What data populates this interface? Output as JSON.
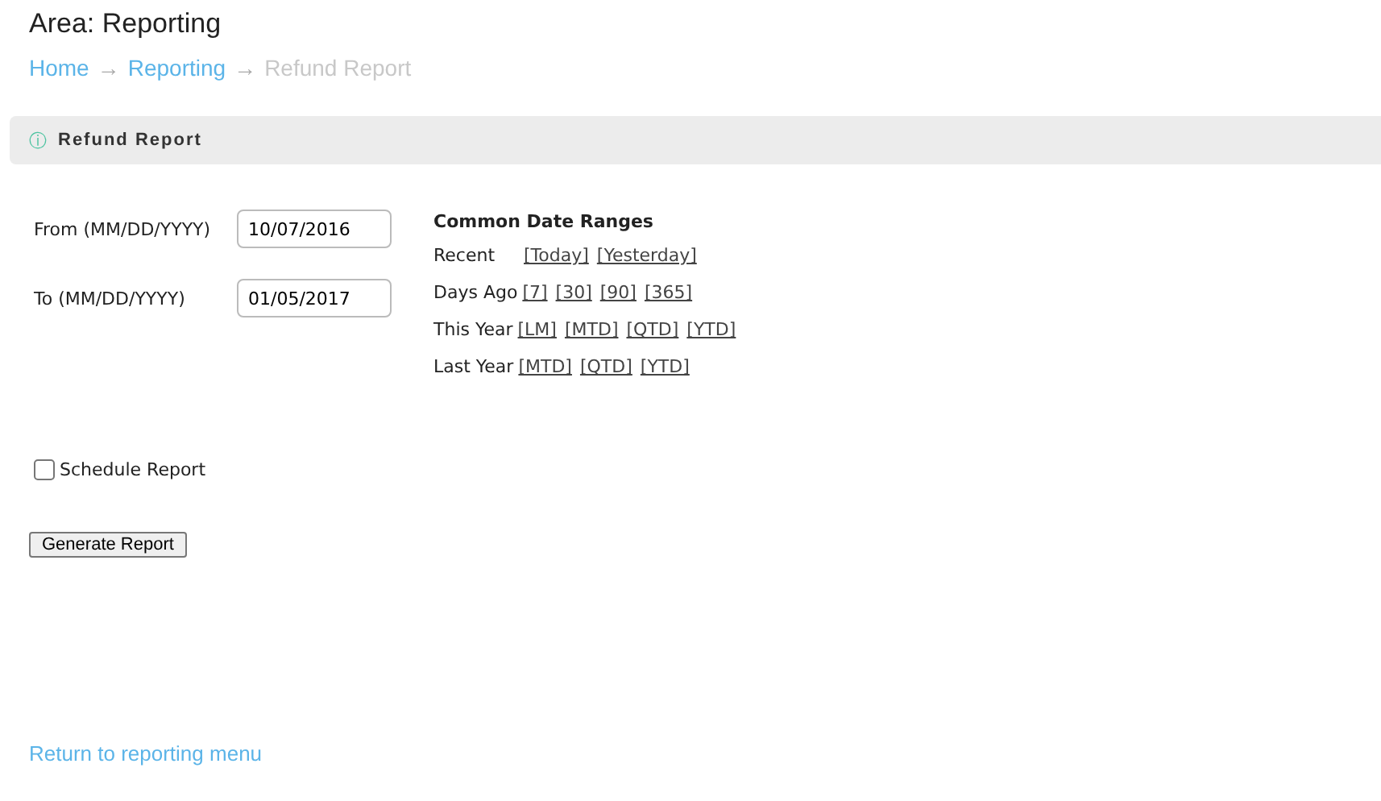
{
  "area_title": "Area: Reporting",
  "breadcrumb": [
    {
      "label": "Home",
      "current": false,
      "separator": "→"
    },
    {
      "label": "Reporting",
      "current": false,
      "separator": "→"
    },
    {
      "label": "Refund Report",
      "current": true
    }
  ],
  "panel": {
    "icon": "ⓘ",
    "title": "Refund Report"
  },
  "date_fields": [
    {
      "label": "From (MM/DD/YYYY)",
      "value": "10/07/2016"
    },
    {
      "label": "To (MM/DD/YYYY)",
      "value": "01/05/2017"
    }
  ],
  "date_ranges": {
    "title": "Common Date Ranges",
    "rows": [
      {
        "label": "Recent",
        "links": [
          "[Today]",
          "[Yesterday]"
        ]
      },
      {
        "label": "Days Ago",
        "links": [
          "[7]",
          "[30]",
          "[90]",
          "[365]"
        ]
      },
      {
        "label": "This Year",
        "links": [
          "[LM]",
          "[MTD]",
          "[QTD]",
          "[YTD]"
        ]
      },
      {
        "label": "Last Year",
        "links": [
          "[MTD]",
          "[QTD]",
          "[YTD]"
        ]
      }
    ]
  },
  "schedule": {
    "label": "Schedule Report",
    "checked": false
  },
  "generate_button": "Generate Report",
  "return_link": "Return to reporting menu"
}
